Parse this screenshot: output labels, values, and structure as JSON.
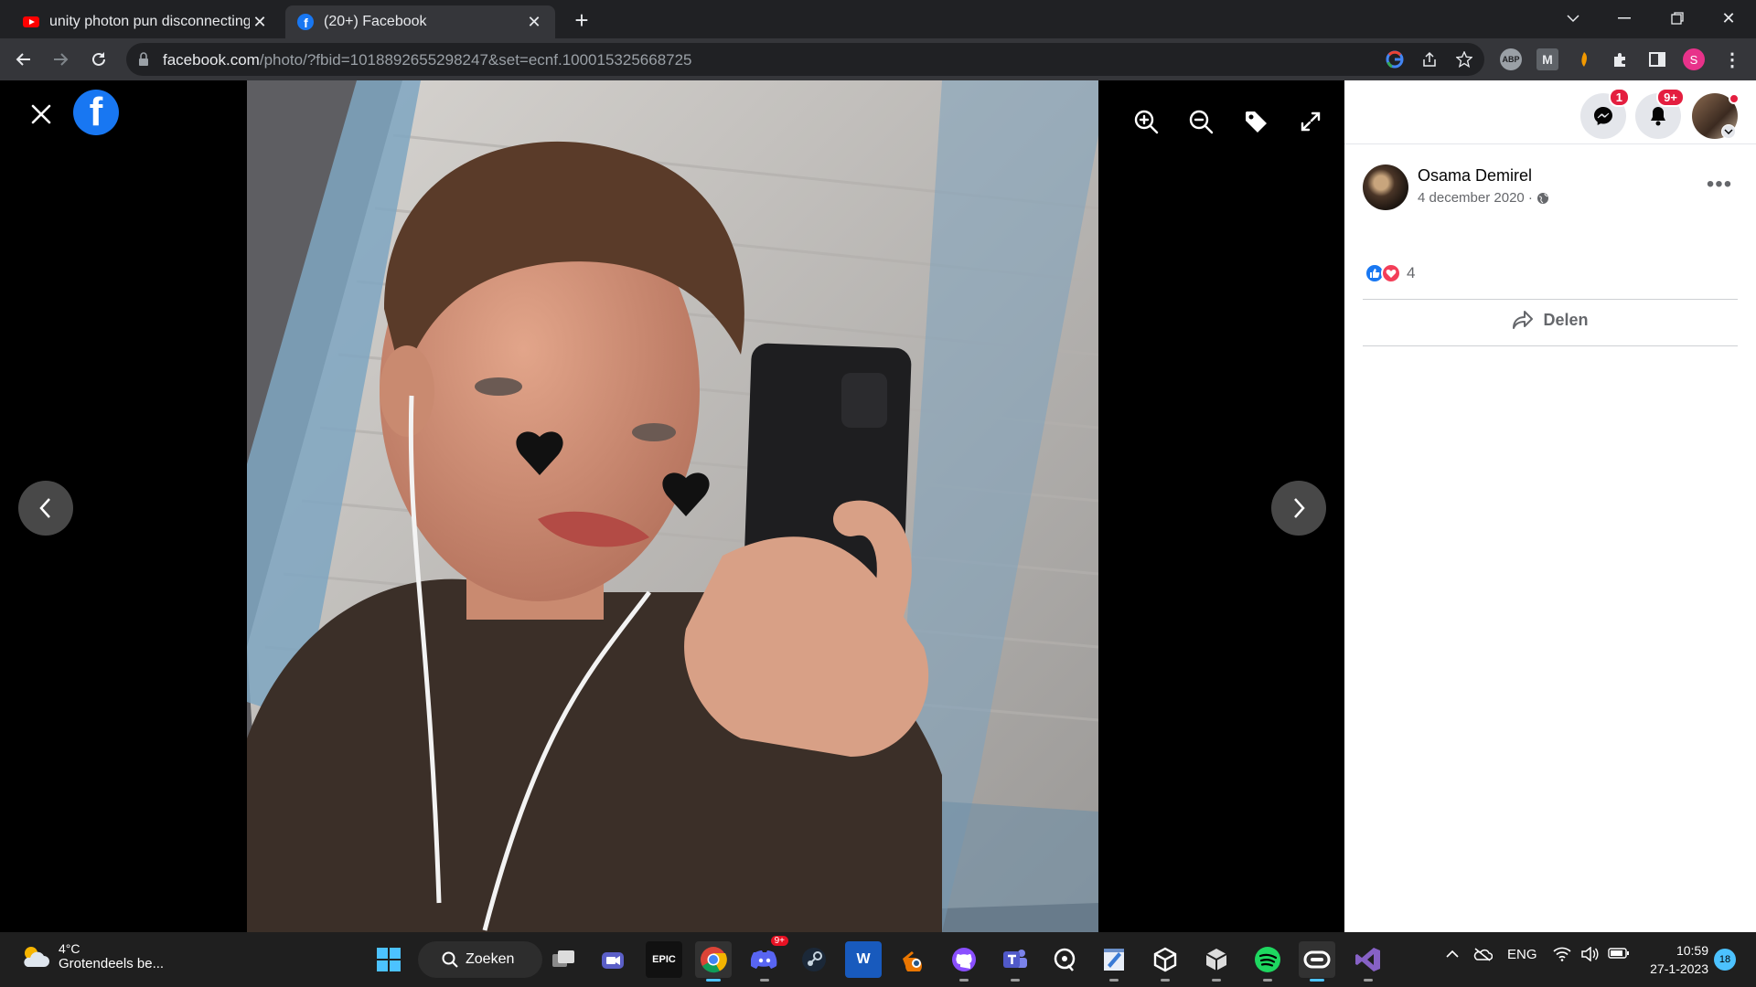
{
  "browser": {
    "tabs": [
      {
        "title": "unity photon pun disconnecting",
        "icon": "youtube-icon",
        "active": false
      },
      {
        "title": "(20+) Facebook",
        "icon": "facebook-icon",
        "active": true
      }
    ],
    "new_tab_label": "+",
    "url_host": "facebook.com",
    "url_path": "/photo/?fbid=1018892655298247&set=ecnf.100015325668725",
    "profile_initial": "S",
    "extensions": [
      "google-icon",
      "share-icon",
      "star-icon",
      "adblock-icon",
      "mendeley-icon",
      "extension-orange-icon",
      "puzzle-icon",
      "sidepanel-icon"
    ],
    "adblock_label": "ABP",
    "m_label": "M"
  },
  "viewer": {
    "tools": [
      "zoom-in-icon",
      "zoom-out-icon",
      "tag-icon",
      "fullscreen-icon"
    ],
    "logo_letter": "f"
  },
  "panel": {
    "messenger_badge": "1",
    "notifications_badge": "9+",
    "author_name": "Osama Demirel",
    "post_date": "4 december 2020 ·",
    "reaction_count": "4",
    "share_label": "Delen",
    "more_label": "•••"
  },
  "taskbar": {
    "weather_temp": "4°C",
    "weather_cond": "Grotendeels be...",
    "search_label": "Zoeken",
    "apps": [
      "windows-start-icon",
      "task-view-icon",
      "meet-icon",
      "epic-games-icon",
      "chrome-icon",
      "discord-icon",
      "steam-icon",
      "word-icon",
      "blender-icon",
      "github-icon",
      "teams-icon",
      "paint-3d-icon",
      "paint-icon",
      "unity-icon",
      "unity-hub-icon",
      "spotify-icon",
      "oculus-icon",
      "visual-studio-icon"
    ],
    "discord_badge": "9+",
    "epic_label": "EPIC",
    "word_label": "W",
    "language": "ENG",
    "time": "10:59",
    "date": "27-1-2023",
    "notification_count": "18"
  },
  "colors": {
    "facebook_blue": "#1877f2",
    "chrome_dark": "#202124",
    "chrome_toolbar": "#35363a",
    "taskbar_bg": "#1f1f1f",
    "badge_red": "#e41e3f"
  }
}
